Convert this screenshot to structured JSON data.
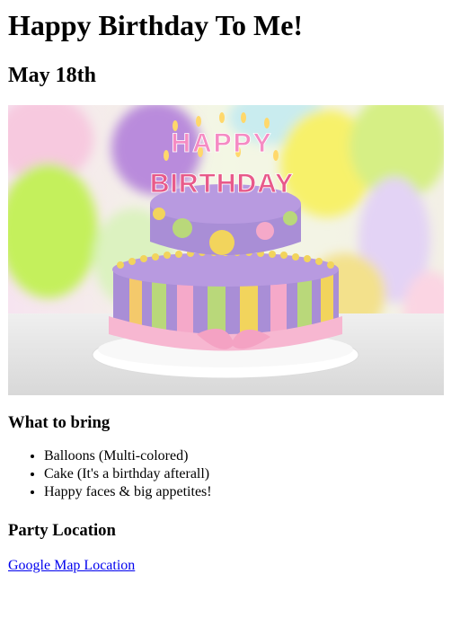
{
  "page": {
    "title": "Happy Birthday To Me!",
    "date": "May 18th"
  },
  "hero_image": {
    "alt": "Birthday cake",
    "cake_lettering": "HAPPY BIRTHDAY"
  },
  "bring": {
    "heading": "What to bring",
    "items": [
      "Balloons (Multi-colored)",
      "Cake (It's a birthday afterall)",
      "Happy faces & big appetites!"
    ]
  },
  "location": {
    "heading": "Party Location",
    "link_text": "Google Map Location"
  },
  "colors": {
    "link": "#0000ee",
    "cake_purple": "#a98ed6",
    "cake_pink": "#f5a9c9",
    "cake_yellow": "#f2d45c",
    "cake_green": "#b9d87a"
  }
}
